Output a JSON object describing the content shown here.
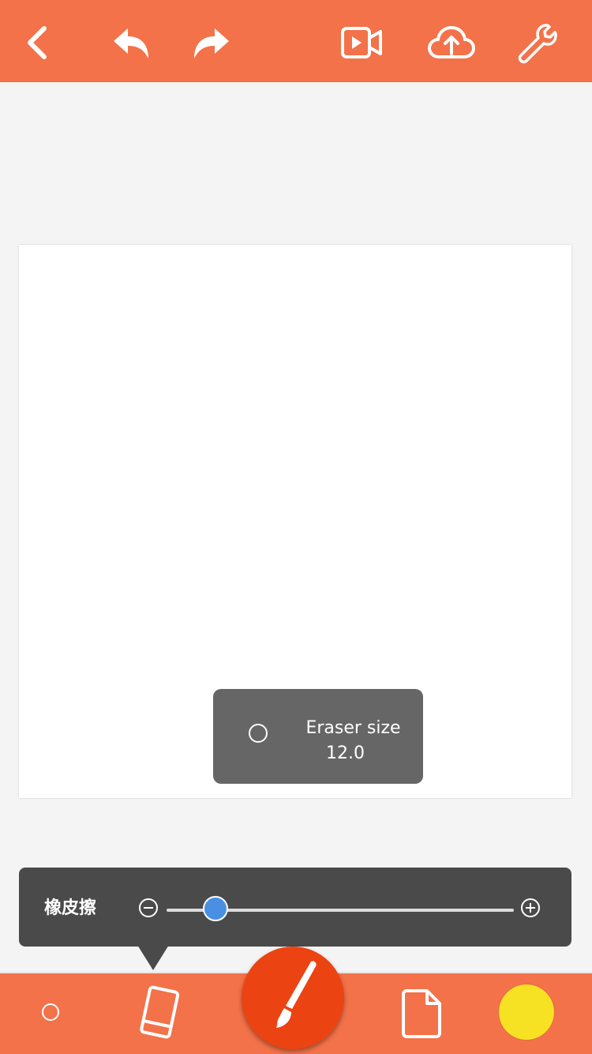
{
  "toolbar": {
    "buttons": [
      "back-icon",
      "undo-icon",
      "redo-icon",
      "video-icon",
      "cloud-upload-icon",
      "wrench-icon"
    ]
  },
  "toast": {
    "label": "Eraser size",
    "value": "12.0"
  },
  "eraser_panel": {
    "label": "橡皮擦",
    "slider_fraction": 0.14
  },
  "bottom_bar": {
    "tools": [
      "brush-size-dot",
      "eraser-icon",
      "brush-icon",
      "page-icon",
      "color-swatch"
    ]
  },
  "colors": {
    "accent": "#f37249",
    "fab": "#eb4412",
    "slider_thumb": "#4a90e2",
    "current_color": "#f7e123"
  }
}
